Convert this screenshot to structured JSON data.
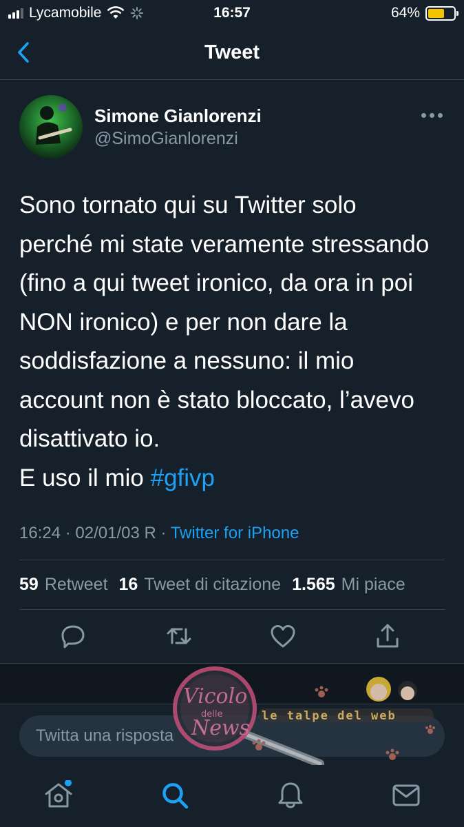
{
  "status_bar": {
    "carrier": "Lycamobile",
    "time": "16:57",
    "battery_percent": "64%",
    "battery_level": 0.64,
    "battery_color": "#f5c400"
  },
  "nav": {
    "title": "Tweet",
    "back_icon": "chevron-left-icon"
  },
  "tweet": {
    "author_name": "Simone Gianlorenzi",
    "author_handle": "@SimoGianlorenzi",
    "text_lines": [
      "Sono tornato qui su Twitter solo",
      "perché mi state veramente stressando",
      "(fino a qui tweet ironico, da ora in poi",
      "NON ironico) e per non dare la",
      "soddisfazione a nessuno: il mio",
      "account non è stato bloccato, l’avevo",
      "disattivato io."
    ],
    "last_line_text": "E uso il mio ",
    "hashtag": "#gfivp",
    "timestamp": "16:24 · 02/01/03 R · ",
    "source": "Twitter for iPhone",
    "stats": {
      "retweets_count": "59",
      "retweets_label": "Retweet",
      "quotes_count": "16",
      "quotes_label": "Tweet di citazione",
      "likes_count": "1.565",
      "likes_label": "Mi piace"
    }
  },
  "actions": [
    "reply-icon",
    "retweet-icon",
    "like-icon",
    "share-icon"
  ],
  "reply_box": {
    "placeholder": "Twitta una risposta"
  },
  "watermark": {
    "brand_left": "Vicolo delle News",
    "brand_right": "le talpe del web"
  },
  "tab_bar": [
    "home-icon",
    "search-icon",
    "notifications-icon",
    "messages-icon"
  ],
  "colors": {
    "background": "#15202b",
    "accent": "#1da1f2",
    "secondary_text": "#8899a6",
    "divider": "#38444d"
  }
}
